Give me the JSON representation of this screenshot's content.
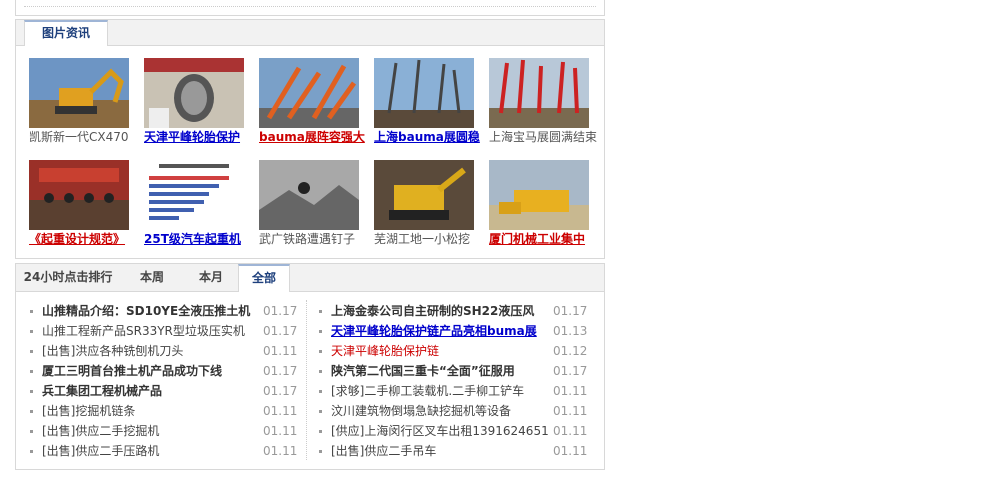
{
  "pictures_section": {
    "tab_label": "图片资讯",
    "items": [
      {
        "caption": "凯斯新一代CX470",
        "style": "plain",
        "image": "excavator-photo"
      },
      {
        "caption": "天津平峰轮胎保护",
        "style": "blue",
        "image": "tire-chain-photo"
      },
      {
        "caption": "bauma展阵容强大",
        "style": "red",
        "image": "orange-cranes-photo"
      },
      {
        "caption": "上海bauma展圆稳",
        "style": "blue",
        "image": "exhibition-cranes-photo"
      },
      {
        "caption": "上海宝马展圆满结束",
        "style": "plain",
        "image": "red-cranes-photo"
      },
      {
        "caption": "《起重设计规范》",
        "style": "red",
        "image": "conference-photo"
      },
      {
        "caption": "25T级汽车起重机",
        "style": "blue",
        "image": "bar-chart-photo"
      },
      {
        "caption": "武广铁路遭遇钉子",
        "style": "plain",
        "image": "rubble-photo"
      },
      {
        "caption": "芜湖工地一小松挖",
        "style": "plain",
        "image": "yellow-machine-photo"
      },
      {
        "caption": "厦门机械工业集中",
        "style": "red",
        "image": "yellow-loader-photo"
      }
    ]
  },
  "ranking_section": {
    "tabs": [
      "24小时点击排行",
      "本周",
      "本月",
      "全部"
    ],
    "active_tab": "全部",
    "left_list": [
      {
        "title": "山推精品介绍：SD10YE全液压推土机",
        "date": "01.17",
        "style": "bold"
      },
      {
        "title": "山推工程新产品SR33YR型垃圾压实机",
        "date": "01.17",
        "style": "plain"
      },
      {
        "title": "[出售]洪应各种铣刨机刀头",
        "date": "01.11",
        "style": "plain"
      },
      {
        "title": "厦工三明首台推土机产品成功下线",
        "date": "01.17",
        "style": "bold"
      },
      {
        "title": "兵工集团工程机械产品",
        "date": "01.17",
        "style": "bold"
      },
      {
        "title": "[出售]挖掘机链条",
        "date": "01.11",
        "style": "plain"
      },
      {
        "title": "[出售]供应二手挖掘机",
        "date": "01.11",
        "style": "plain"
      },
      {
        "title": "[出售]供应二手压路机",
        "date": "01.11",
        "style": "plain"
      }
    ],
    "right_list": [
      {
        "title": "上海金泰公司自主研制的SH22液压风",
        "date": "01.17",
        "style": "bold"
      },
      {
        "title": "天津平峰轮胎保护链产品亮相buma展",
        "date": "01.13",
        "style": "blue"
      },
      {
        "title": "天津平峰轮胎保护链",
        "date": "01.12",
        "style": "red"
      },
      {
        "title": "陕汽第二代国三重卡“全面”征服用",
        "date": "01.17",
        "style": "bold"
      },
      {
        "title": "[求够]二手柳工装载机.二手柳工铲车",
        "date": "01.11",
        "style": "plain"
      },
      {
        "title": "汶川建筑物倒塌急缺挖掘机等设备",
        "date": "01.11",
        "style": "plain"
      },
      {
        "title": "[供应]上海闵行区叉车出租1391624651",
        "date": "01.11",
        "style": "plain"
      },
      {
        "title": "[出售]供应二手吊车",
        "date": "01.11",
        "style": "plain"
      }
    ]
  },
  "colors": {
    "accent_blue": "#1d3f7c",
    "link_blue": "#0000cc",
    "link_red": "#cc0000"
  }
}
